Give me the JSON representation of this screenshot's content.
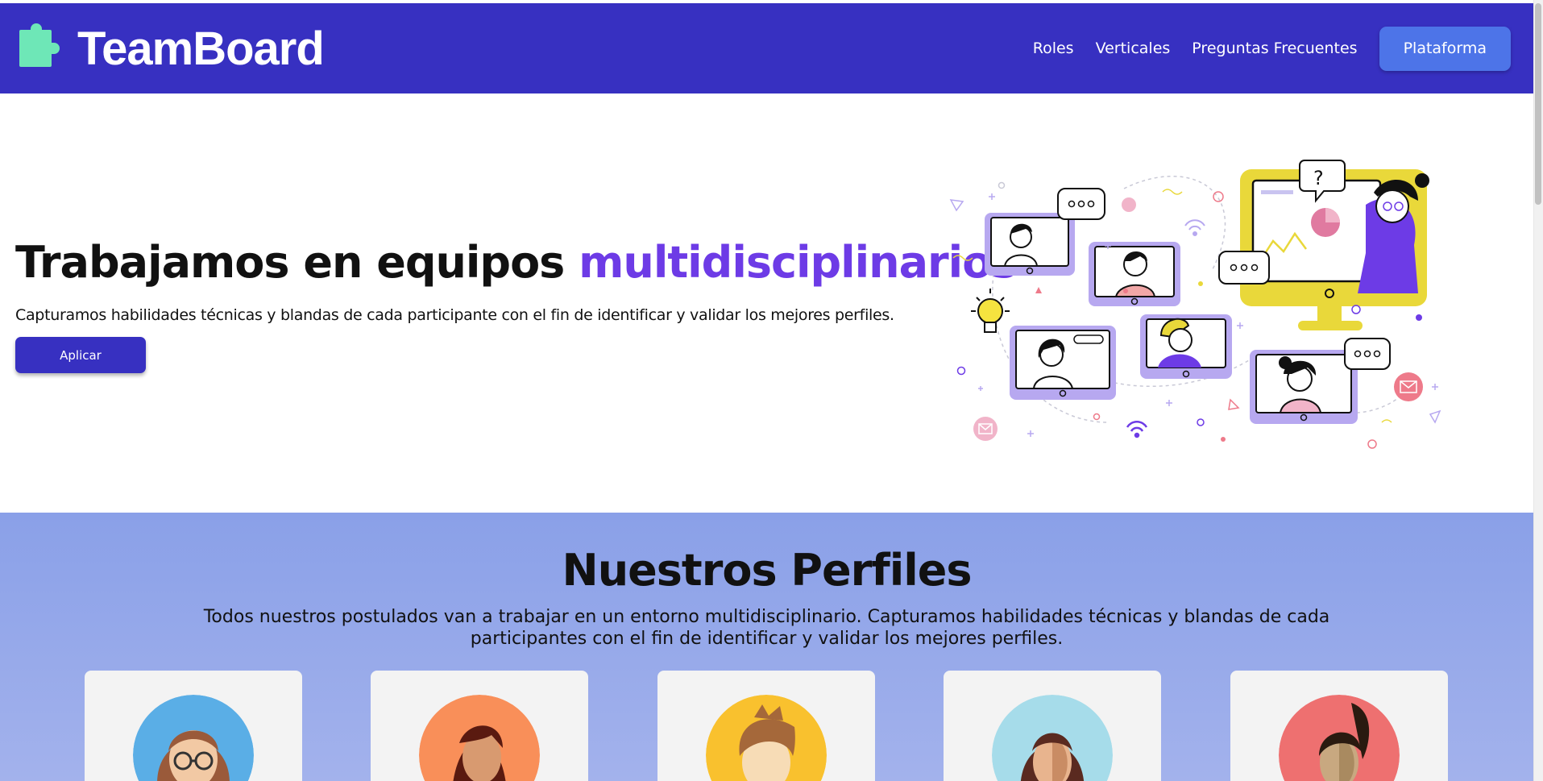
{
  "header": {
    "brand_name": "TeamBoard",
    "nav": [
      {
        "label": "Roles"
      },
      {
        "label": "Verticales"
      },
      {
        "label": "Preguntas Frecuentes"
      }
    ],
    "cta_label": "Plataforma"
  },
  "hero": {
    "title_prefix": "Trabajamos en equipos ",
    "title_accent": "multidisciplinarios",
    "subtitle": "Capturamos habilidades técnicas y blandas de cada participante con el fin de identificar y validar los mejores perfiles.",
    "button_label": "Aplicar"
  },
  "profiles": {
    "title": "Nuestros Perfiles",
    "subtitle": "Todos nuestros postulados van a trabajar en un entorno multidisciplinario. Capturamos habilidades técnicas y blandas de cada participantes con el fin de identificar y validar los mejores perfiles.",
    "cards": [
      {
        "avatar_icon": "woman-glasses-avatar-icon",
        "bg": "#5aaee6"
      },
      {
        "avatar_icon": "woman-dark-hair-avatar-icon",
        "bg": "#f98f59"
      },
      {
        "avatar_icon": "man-brown-hair-avatar-icon",
        "bg": "#f9c12e"
      },
      {
        "avatar_icon": "woman-curly-hair-avatar-icon",
        "bg": "#a6dcea"
      },
      {
        "avatar_icon": "woman-ponytail-avatar-icon",
        "bg": "#ee7070"
      }
    ]
  },
  "colors": {
    "header_bg": "#3730c1",
    "accent_purple": "#6d3be6",
    "cta_blue": "#4d74e8",
    "brand_green": "#6ee7b7",
    "profiles_bg": "#8aa0e8"
  }
}
